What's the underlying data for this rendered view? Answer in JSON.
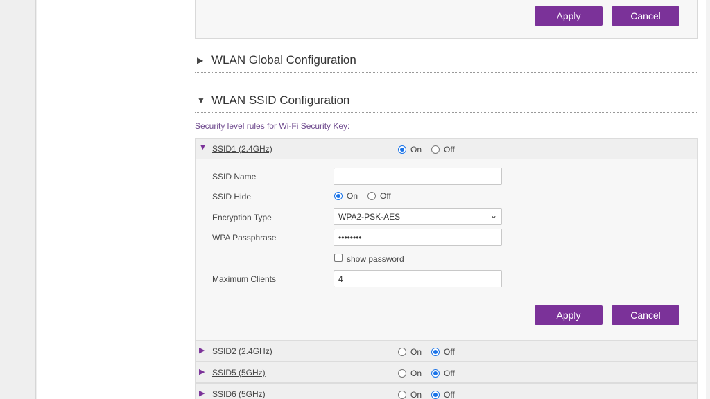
{
  "top_panel": {
    "apply_label": "Apply",
    "cancel_label": "Cancel"
  },
  "sections": {
    "global": {
      "title": "WLAN Global Configuration",
      "arrow": "▶"
    },
    "ssid": {
      "title": "WLAN SSID Configuration",
      "arrow": "▼"
    }
  },
  "rules_link": "Security level rules for Wi-Fi Security Key:",
  "radio_labels": {
    "on": "On",
    "off": "Off"
  },
  "ssid1": {
    "label": "SSID1 (2.4GHz)",
    "arrow": "▼",
    "state": "On",
    "fields": {
      "ssid_name": {
        "label": "SSID Name",
        "value": ""
      },
      "ssid_hide": {
        "label": "SSID Hide",
        "state": "On"
      },
      "encryption": {
        "label": "Encryption Type",
        "value": "WPA2-PSK-AES"
      },
      "passphrase": {
        "label": "WPA Passphrase",
        "value": "••••••••"
      },
      "show_password": {
        "label": "show password",
        "checked": false
      },
      "max_clients": {
        "label": "Maximum Clients",
        "value": "4"
      }
    },
    "apply_label": "Apply",
    "cancel_label": "Cancel"
  },
  "other_ssids": [
    {
      "label": "SSID2 (2.4GHz)",
      "arrow": "▶",
      "state": "Off"
    },
    {
      "label": "SSID5 (5GHz)",
      "arrow": "▶",
      "state": "Off"
    },
    {
      "label": "SSID6 (5GHz)",
      "arrow": "▶",
      "state": "Off"
    }
  ],
  "icons": {
    "collapsed": "triangle-right-icon",
    "expanded": "triangle-down-icon",
    "dropdown": "chevron-down-icon"
  },
  "colors": {
    "accent": "#7b3299",
    "radio_selected": "#1a73e8",
    "link": "#6f4a8e"
  }
}
